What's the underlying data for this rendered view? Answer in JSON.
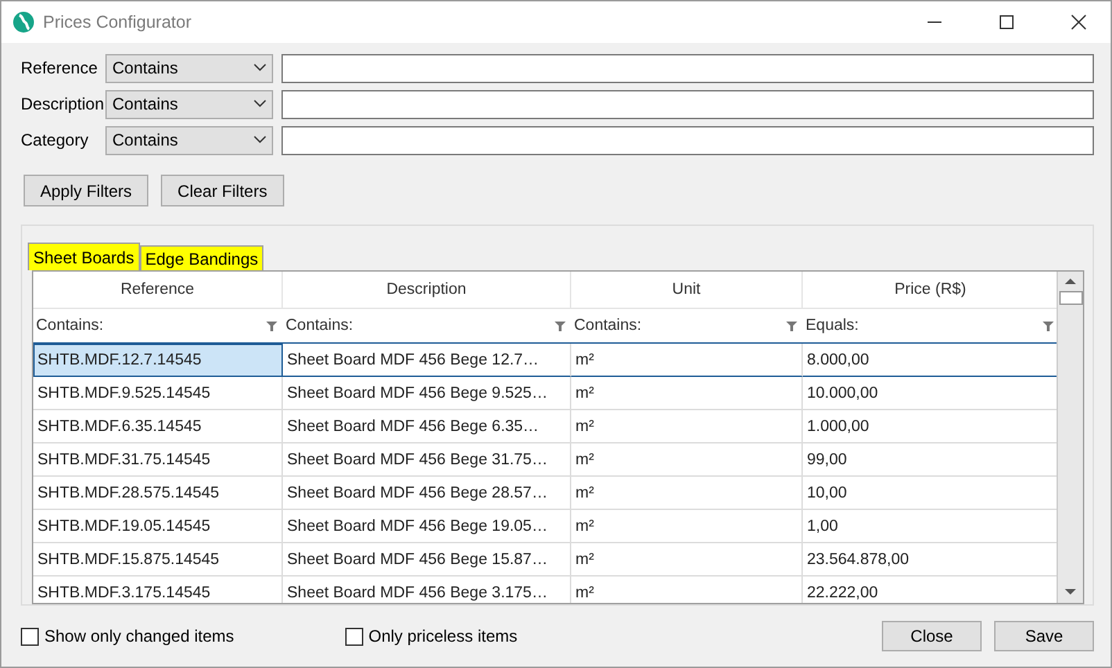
{
  "window": {
    "title": "Prices Configurator"
  },
  "filters": [
    {
      "label": "Reference",
      "operator": "Contains"
    },
    {
      "label": "Description",
      "operator": "Contains"
    },
    {
      "label": "Category",
      "operator": "Contains"
    }
  ],
  "filter_buttons": [
    "Apply Filters",
    "Clear Filters"
  ],
  "tabs": [
    {
      "label": "Sheet Boards",
      "selected": true
    },
    {
      "label": "Edge Bandings",
      "selected": false
    }
  ],
  "table": {
    "columns": [
      {
        "label": "Reference",
        "filter": "Contains:"
      },
      {
        "label": "Description",
        "filter": "Contains:"
      },
      {
        "label": "Unit",
        "filter": "Contains:"
      },
      {
        "label": "Price (R$)",
        "filter": "Equals:"
      }
    ],
    "rows": [
      {
        "selected": true,
        "cells": [
          "SHTB.MDF.12.7.14545",
          "Sheet Board MDF 456 Bege 12.7…",
          "m²",
          "8.000,00"
        ]
      },
      {
        "selected": false,
        "cells": [
          "SHTB.MDF.9.525.14545",
          "Sheet Board MDF 456 Bege 9.525…",
          "m²",
          "10.000,00"
        ]
      },
      {
        "selected": false,
        "cells": [
          "SHTB.MDF.6.35.14545",
          "Sheet Board MDF 456 Bege 6.35…",
          "m²",
          "1.000,00"
        ]
      },
      {
        "selected": false,
        "cells": [
          "SHTB.MDF.31.75.14545",
          "Sheet Board MDF 456 Bege 31.75…",
          "m²",
          "99,00"
        ]
      },
      {
        "selected": false,
        "cells": [
          "SHTB.MDF.28.575.14545",
          "Sheet Board MDF 456 Bege 28.57…",
          "m²",
          "10,00"
        ]
      },
      {
        "selected": false,
        "cells": [
          "SHTB.MDF.19.05.14545",
          "Sheet Board MDF 456 Bege 19.05…",
          "m²",
          "1,00"
        ]
      },
      {
        "selected": false,
        "cells": [
          "SHTB.MDF.15.875.14545",
          "Sheet Board MDF 456 Bege 15.87…",
          "m²",
          "23.564.878,00"
        ]
      },
      {
        "selected": false,
        "cells": [
          "SHTB.MDF.3.175.14545",
          "Sheet Board MDF 456 Bege 3.175…",
          "m²",
          "22.222,00"
        ]
      }
    ]
  },
  "options": [
    {
      "label": "Show only changed items",
      "checked": false
    },
    {
      "label": "Only priceless items",
      "checked": false
    }
  ],
  "buttons": [
    "Close",
    "Save"
  ]
}
